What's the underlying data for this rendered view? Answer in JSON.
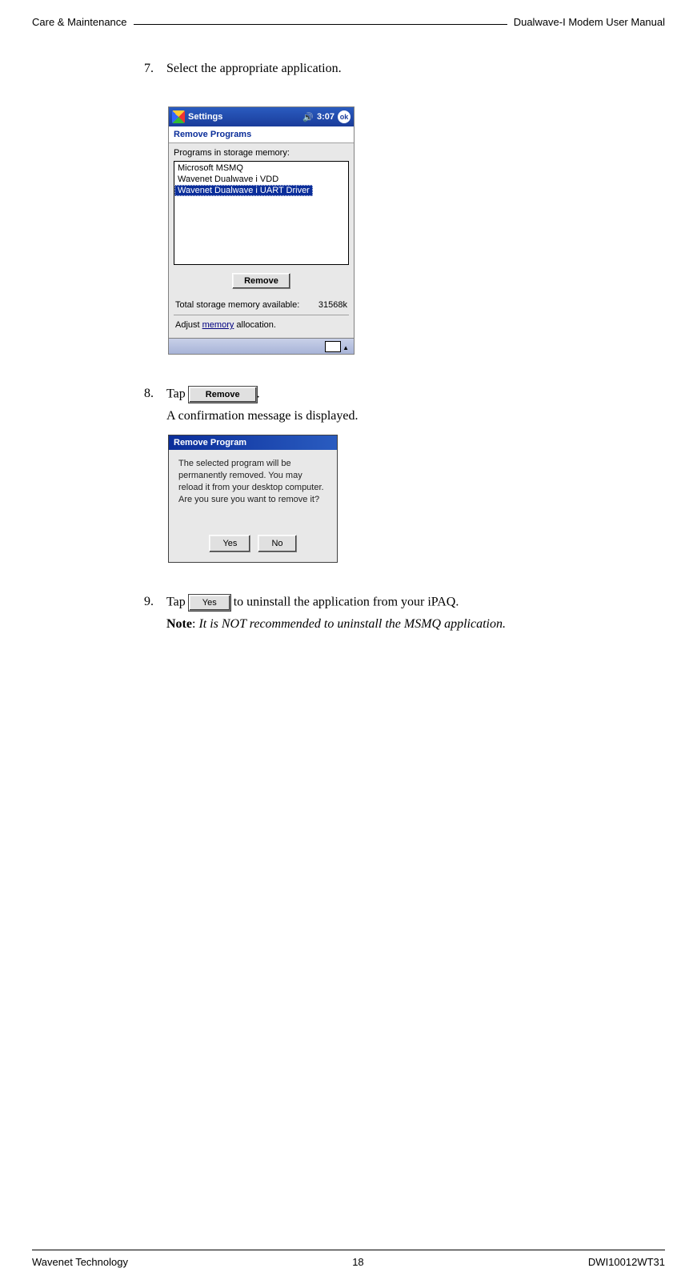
{
  "header": {
    "left": "Care & Maintenance",
    "right": "Dualwave-I Modem User Manual"
  },
  "footer": {
    "left": "Wavenet Technology",
    "center": "18",
    "right": "DWI10012WT31"
  },
  "steps": {
    "s7": {
      "num": "7.",
      "text": "Select the appropriate application."
    },
    "s8": {
      "num": "8.",
      "tap_prefix": "Tap ",
      "remove_btn": "Remove",
      "tap_suffix": ".",
      "line2": "A confirmation message is displayed."
    },
    "s9": {
      "num": "9.",
      "tap_prefix": "Tap ",
      "yes_btn": "Yes",
      "tap_suffix": " to uninstall the application from your iPAQ.",
      "note_label": "Note",
      "note_sep": ": ",
      "note_text": "It is NOT recommended to uninstall the MSMQ application."
    }
  },
  "ipaq": {
    "title": "Settings",
    "time": "3:07",
    "ok": "ok",
    "tab": "Remove Programs",
    "programs_label": "Programs in storage memory:",
    "items": {
      "0": "Microsoft MSMQ",
      "1": "Wavenet Dualwave i VDD",
      "2": "Wavenet Dualwave i UART Driver"
    },
    "remove_button": "Remove",
    "mem_label": "Total storage memory available:",
    "mem_value": "31568k",
    "adjust_prefix": "Adjust ",
    "adjust_link": "memory",
    "adjust_suffix": " allocation."
  },
  "dialog": {
    "title": "Remove Program",
    "text": "The selected program will be permanently removed. You may reload it from your desktop computer. Are you sure you want to remove it?",
    "yes": "Yes",
    "no": "No"
  }
}
